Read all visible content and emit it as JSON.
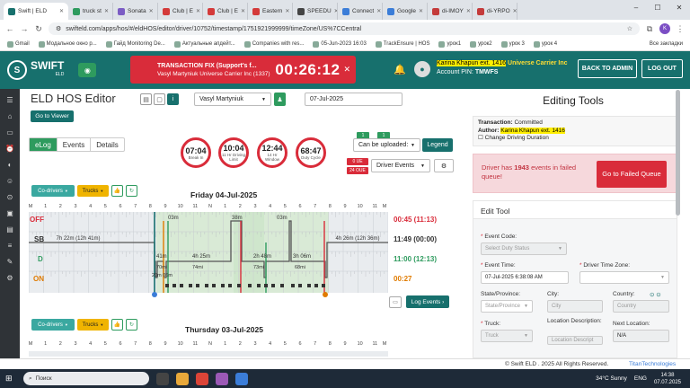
{
  "browser": {
    "tabs": [
      {
        "label": "Swift | ELD",
        "color": "#17706d",
        "active": true
      },
      {
        "label": "truck st",
        "color": "#2e9b5e"
      },
      {
        "label": "Sonata",
        "color": "#7b5cc4"
      },
      {
        "label": "Club | E",
        "color": "#d43a3a"
      },
      {
        "label": "Club | E",
        "color": "#d43a3a"
      },
      {
        "label": "Eastern",
        "color": "#d43a3a"
      },
      {
        "label": "SPEEDU",
        "color": "#444"
      },
      {
        "label": "Connect",
        "color": "#3b7dd8"
      },
      {
        "label": "Google",
        "color": "#3b7dd8"
      },
      {
        "label": "di-IMOY",
        "color": "#c43b3b"
      },
      {
        "label": "di-YRPO",
        "color": "#c43b3b"
      }
    ],
    "url": "swifteld.com/apps/hos/#/eldHOS/editor/driver/10752/timestamp/1751921999999/timeZone/US%7CCentral",
    "bookmarks": [
      "Gmail",
      "Модальное окно р...",
      "Гайд Monitoring De...",
      "Актуальные апдейт...",
      "Companies with res...",
      "05-Jun-2023 16:03",
      "TrackEnsure | HOS",
      "урок1",
      "урок2",
      "урок 3",
      "урок 4"
    ],
    "all_bookmarks": "Все закладки",
    "profile_letter": "K"
  },
  "header": {
    "logo_text": "SWIFT",
    "logo_sub": "ELD",
    "transaction_title": "TRANSACTION FIX (Support's f...",
    "transaction_sub": "Vasyl Martyniuk   Universe Carrier Inc (1337)",
    "timer": "00:26:12",
    "user_name": "Karina Khapun ext. 1416",
    "carrier": "Universe Carrier Inc",
    "pin_label": "Account PIN:",
    "pin": "TMWFS",
    "back_label": "BACK TO ADMIN",
    "logout_label": "LOG OUT",
    "accent": "#17706d",
    "alert": "#d92c3a"
  },
  "editor": {
    "title": "ELD HOS Editor",
    "driver": "Vasyl Martyniuk",
    "date": "07-Jul-2025",
    "go_viewer": "Go to Viewer",
    "tabs": [
      "eLog",
      "Events",
      "Details"
    ],
    "gauges": [
      {
        "value": "07:04",
        "label": "Break In"
      },
      {
        "value": "10:04",
        "label": "11 Hr Driving Limit"
      },
      {
        "value": "12:44",
        "label": "14 Hr Window"
      },
      {
        "value": "68:47",
        "label": "Duty Cycle"
      }
    ],
    "can_upload": "Can be uploaded:",
    "legend": "Legend",
    "driver_events": "Driver Events",
    "ue_top": "0 UE",
    "ue_bottom": "24 OUE",
    "counter_a": "1",
    "counter_b": "1",
    "co_drivers": "Co-drivers",
    "trucks": "Trucks",
    "log_events": "Log Events",
    "days": [
      {
        "title": "Friday 04-Jul-2025",
        "rows": [
          {
            "label": "OFF",
            "color": "#d92c3a",
            "total": "00:45 (11:13)"
          },
          {
            "label": "SB",
            "color": "#333",
            "total": "11:49 (00:00)"
          },
          {
            "label": "D",
            "color": "#2e9b5e",
            "total": "11:00 (12:13)"
          },
          {
            "label": "ON",
            "color": "#e07b00",
            "total": "00:27"
          }
        ],
        "annotations": {
          "sb_left": "7h 22m (12h 41m)",
          "sb_right": "4h 26m (12h 36m)",
          "off_a": "03m",
          "off_b": "38m",
          "off_c": "03m",
          "d_a": "4h 25m",
          "d_b": "2h 48m",
          "d_c": "3h 06m",
          "d_small": "41m",
          "s_a": "70mi",
          "s_b": "74mi",
          "s_c": "73mi",
          "s_d": "68mi",
          "on_a": "20m 06m"
        },
        "hour_labels": [
          "M",
          "1",
          "2",
          "3",
          "4",
          "5",
          "6",
          "7",
          "8",
          "9",
          "10",
          "11",
          "N",
          "1",
          "2",
          "3",
          "4",
          "5",
          "6",
          "7",
          "8",
          "9",
          "10",
          "11",
          "M"
        ]
      },
      {
        "title": "Thursday 03-Jul-2025"
      }
    ]
  },
  "panel": {
    "title": "Editing Tools",
    "transaction_label": "Transaction:",
    "transaction_value": "Committed",
    "author_label": "Author:",
    "author_value": "Karina Khapun ext. 1416",
    "change_duration": "Change Driving Duration",
    "failed_msg_pre": "Driver has",
    "failed_count": "1943",
    "failed_msg_post": "events in failed queue!",
    "failed_btn": "Go to Failed Queue",
    "edit_tool": "Edit Tool",
    "event_code_label": "Event Code:",
    "event_code_ph": "Select Duty Status",
    "event_time_label": "Event Time:",
    "event_time_value": "07-Jul-2025 6:38:08 AM",
    "driver_tz_label": "Driver Time Zone:",
    "state_label": "State/Province:",
    "state_ph": "State/Province",
    "city_label": "City:",
    "city_ph": "City",
    "country_label": "Country:",
    "country_ph": "Country",
    "truck_label": "Truck:",
    "truck_ph": "Truck",
    "location_label": "Location Description:",
    "location_ph": "Location Descript",
    "next_location_label": "Next Location:",
    "next_location_value": "N/A"
  },
  "footer": {
    "copyright": "© Swift ELD . 2025 All Rights Reserved.",
    "powered": "TitanTechnologies"
  },
  "taskbar": {
    "search": "Поиск",
    "weather": "34°C  Sunny",
    "lang": "ENG",
    "time": "14:38",
    "date": "07.07.2025"
  }
}
